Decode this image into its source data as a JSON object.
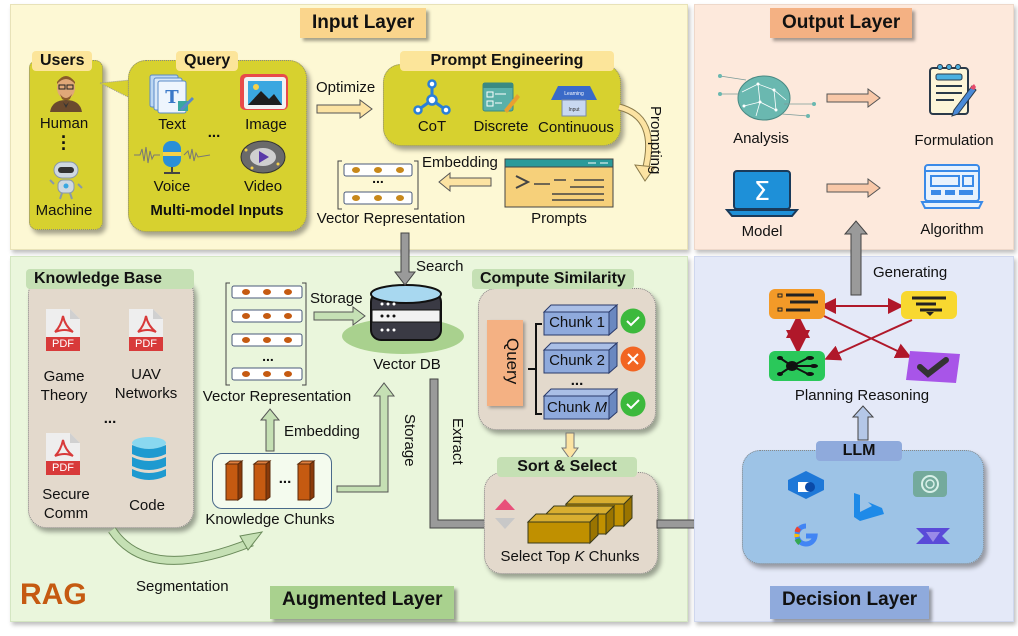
{
  "input_layer": {
    "title": "Input Layer",
    "users": {
      "title": "Users",
      "items": [
        "Human",
        "Machine"
      ]
    },
    "query": {
      "title": "Query",
      "items": [
        "Text",
        "Image",
        "Voice",
        "Video"
      ],
      "ellipsis": "...",
      "caption": "Multi-model Inputs"
    },
    "optimize_label": "Optimize",
    "prompt_engineering": {
      "title": "Prompt Engineering",
      "items": [
        "CoT",
        "Discrete",
        "Continuous"
      ],
      "continuous_icon_text": [
        "Learning",
        "Input"
      ]
    },
    "prompting_label": "Prompting",
    "prompts_label": "Prompts",
    "embedding_label": "Embedding",
    "vector_representation_label": "Vector Representation",
    "vector_ellipsis": "..."
  },
  "output_layer": {
    "title": "Output Layer",
    "items": [
      "Analysis",
      "Formulation",
      "Model",
      "Algorithm"
    ]
  },
  "augmented_layer": {
    "title": "Augmented Layer",
    "rag_label": "RAG",
    "knowledge_base": {
      "title": "Knowledge Base",
      "docs": [
        {
          "badge": "PDF",
          "label_line1": "Game",
          "label_line2": "Theory"
        },
        {
          "badge": "PDF",
          "label_line1": "UAV",
          "label_line2": "Networks"
        },
        {
          "badge": "PDF",
          "label_line1": "Secure",
          "label_line2": "Comm"
        }
      ],
      "code_label": "Code",
      "ellipsis": "..."
    },
    "segmentation_label": "Segmentation",
    "knowledge_chunks_label": "Knowledge Chunks",
    "chunks_ellipsis": "...",
    "embedding_label": "Embedding",
    "vector_representation_label": "Vector Representation",
    "vector_ellipsis": "...",
    "storage_label_top": "Storage",
    "storage_label_vertical": "Storage",
    "vector_db_label": "Vector DB",
    "search_label": "Search",
    "extract_label": "Extract",
    "compute_similarity": {
      "title": "Compute Similarity",
      "query_label": "Query",
      "chunks": [
        {
          "label": "Chunk 1",
          "status": "match"
        },
        {
          "label": "Chunk 2",
          "status": "reject"
        },
        {
          "label": "Chunk M",
          "status": "match"
        }
      ],
      "ellipsis": "..."
    },
    "sort_select": {
      "title": "Sort & Select",
      "caption_pre": "Select Top ",
      "caption_k": "K",
      "caption_post": " Chunks"
    }
  },
  "decision_layer": {
    "title": "Decision Layer",
    "generating_label": "Generating",
    "planning_reasoning_label": "Planning Reasoning",
    "llm_label": "LLM",
    "llm_icons": [
      "cube-model-icon",
      "bing-icon",
      "chatgpt-icon",
      "google-icon",
      "gemini-star-icon"
    ]
  },
  "colors": {
    "input_bg": "#fdf8d4",
    "input_title_bg": "#fad58c",
    "query_box": "#d7d12f",
    "output_bg": "#fde9dc",
    "output_title_bg": "#f4b183",
    "augmented_bg": "#eaf6dc",
    "augmented_title_bg": "#a9d18e",
    "decision_bg": "#e4e9f8",
    "decision_title_bg": "#8faadc",
    "llm_box": "#9dc3e6",
    "chunk_blue": "#8faadc",
    "match_green": "#3cb93c",
    "reject_orange": "#f26522",
    "rag_orange": "#c55a11"
  }
}
